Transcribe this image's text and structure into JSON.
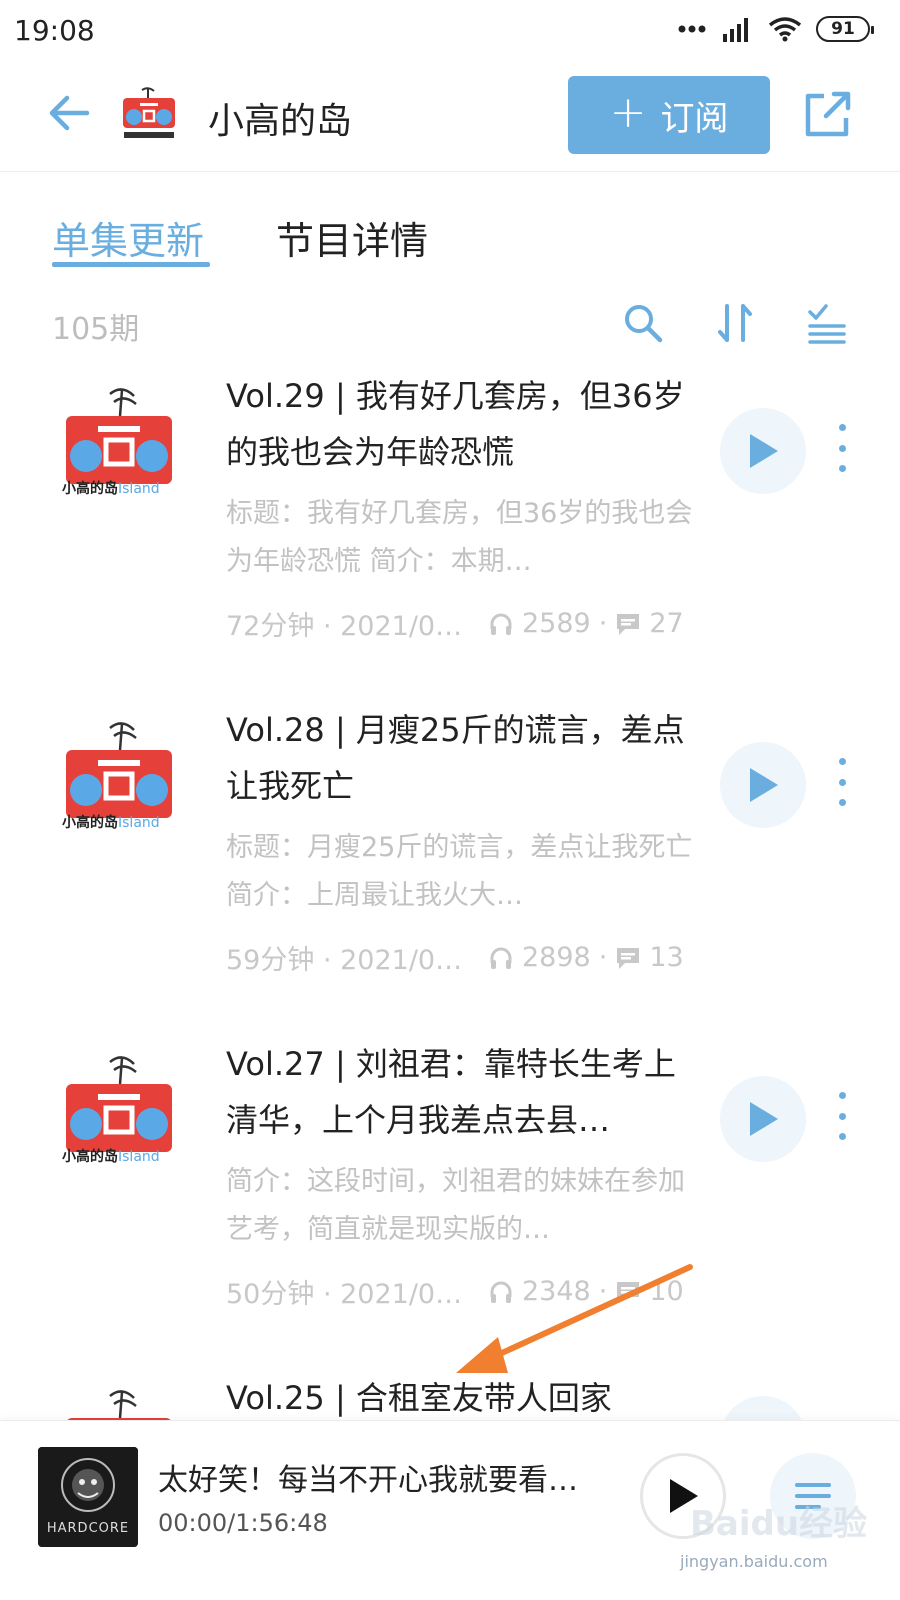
{
  "status_bar": {
    "time": "19:08",
    "battery": "91"
  },
  "header": {
    "title": "小高的岛",
    "subscribe_label": "订阅",
    "accent_color": "#6aaee0"
  },
  "tabs": [
    {
      "label": "单集更新",
      "active": true
    },
    {
      "label": "节目详情",
      "active": false
    }
  ],
  "toolbar": {
    "count": "105期",
    "icons": [
      "search-icon",
      "sort-icon",
      "filter-list-icon"
    ]
  },
  "logo_caption": {
    "cn": "小高的岛",
    "en": "Island"
  },
  "episodes": [
    {
      "title": "Vol.29 | 我有好几套房，但36岁的我也会为年龄恐慌",
      "desc": "标题：我有好几套房，但36岁的我也会为年龄恐慌 简介：本期…",
      "duration": "72分钟 · 2021/0…",
      "plays": "2589",
      "comments": "27"
    },
    {
      "title": "Vol.28 | 月瘦25斤的谎言，差点让我死亡",
      "desc": "标题：月瘦25斤的谎言，差点让我死亡 简介：上周最让我火大…",
      "duration": "59分钟 · 2021/0…",
      "plays": "2898",
      "comments": "13"
    },
    {
      "title": "Vol.27 | 刘祖君：靠特长生考上清华，上个月我差点去县…",
      "desc": "简介：这段时间，刘祖君的妹妹在参加艺考，简直就是现实版的…",
      "duration": "50分钟 · 2021/0…",
      "plays": "2348",
      "comments": "10"
    },
    {
      "title": "Vol.25 | 合租室友带人回家",
      "desc": "",
      "duration": "",
      "plays": "",
      "comments": ""
    }
  ],
  "player": {
    "title": "太好笑！每当不开心我就要看…",
    "time": "00:00/1:56:48",
    "cover_text": "HARDCORE"
  },
  "watermark": {
    "brand": "Baidu经验",
    "url": "jingyan.baidu.com"
  }
}
